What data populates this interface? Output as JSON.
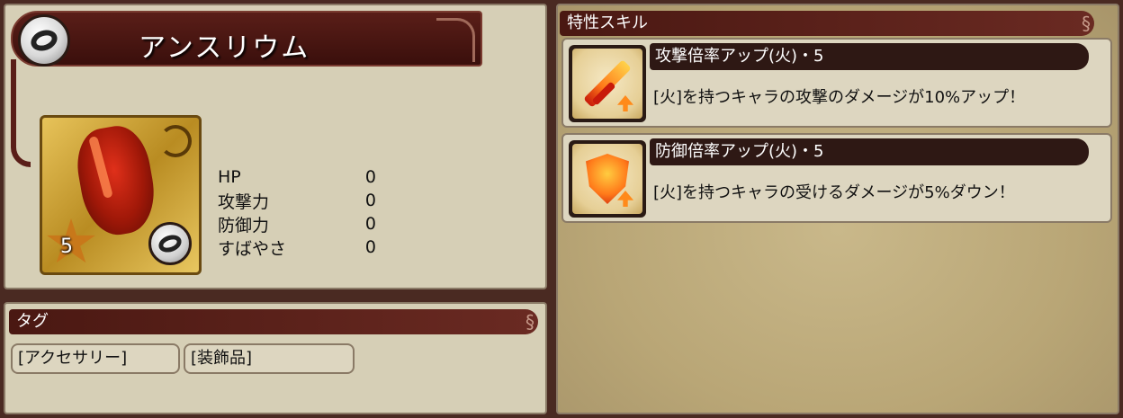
{
  "item": {
    "name": "アンスリウム",
    "rarity": "5",
    "icon_type": "ring-icon"
  },
  "stats": [
    {
      "label": "HP",
      "value": "0"
    },
    {
      "label": "攻撃力",
      "value": "0"
    },
    {
      "label": "防御力",
      "value": "0"
    },
    {
      "label": "すばやさ",
      "value": "0"
    }
  ],
  "tags": {
    "header": "タグ",
    "items": [
      "[アクセサリー]",
      "[装飾品]"
    ]
  },
  "skills": {
    "header": "特性スキル",
    "items": [
      {
        "title": "攻撃倍率アップ(火)・5",
        "description": "[火]を持つキャラの攻撃のダメージが10%アップ！",
        "icon": "sword-up-icon"
      },
      {
        "title": "防御倍率アップ(火)・5",
        "description": "[火]を持つキャラの受けるダメージが5%ダウン！",
        "icon": "shield-up-icon"
      }
    ]
  },
  "colors": {
    "banner": "#4a1812",
    "panel": "#d6cfb6",
    "right_panel": "#b9a676"
  }
}
